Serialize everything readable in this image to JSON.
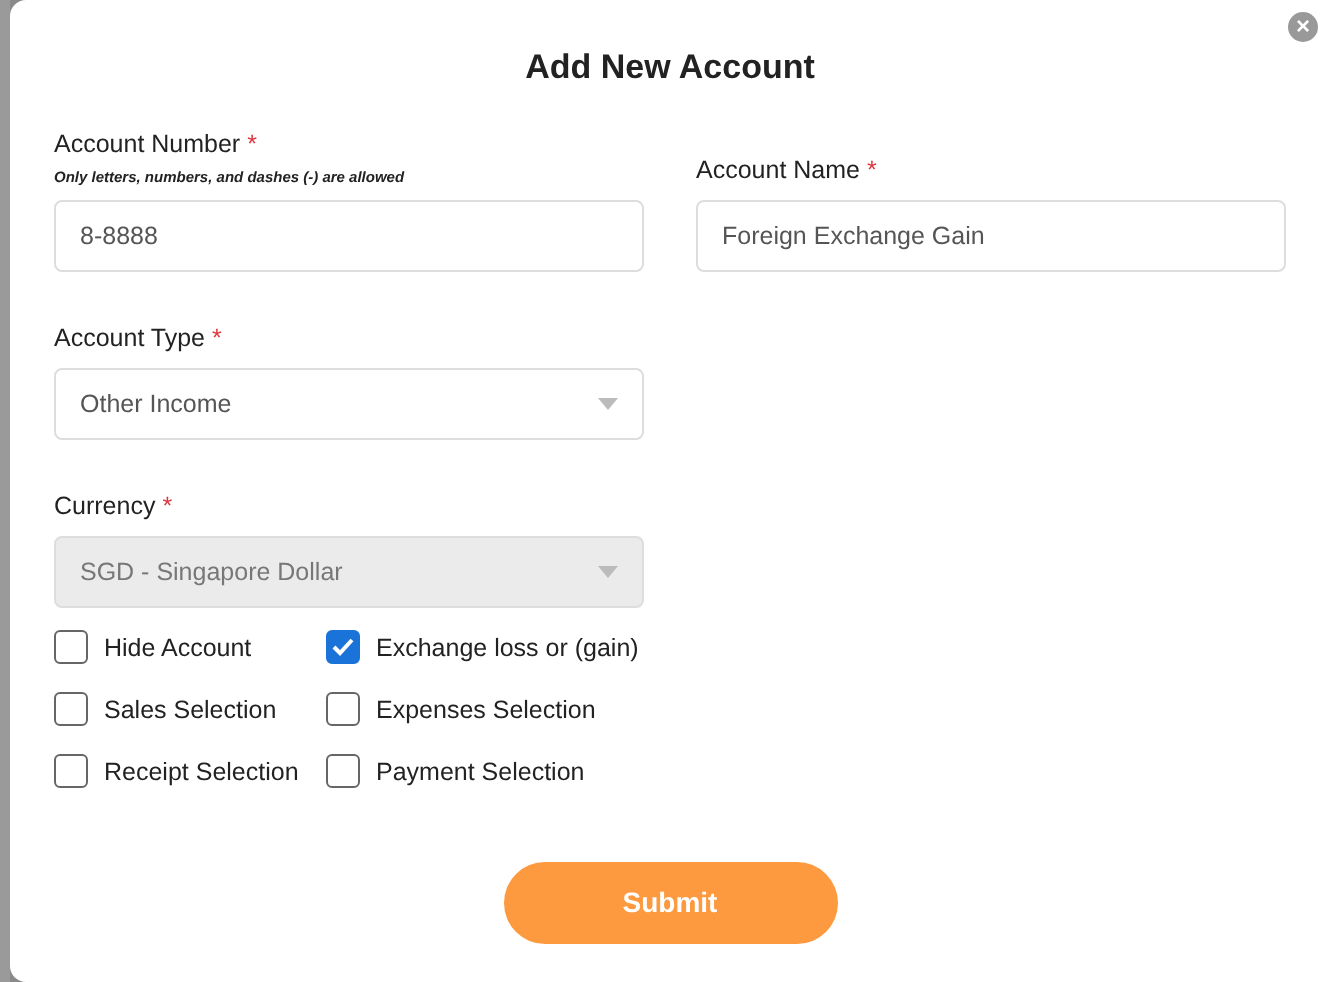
{
  "modal": {
    "title": "Add New Account",
    "close_label": "×"
  },
  "fields": [
    {
      "label": "Account Number",
      "required_mark": "*",
      "hint": "Only letters, numbers, and dashes (-) are allowed",
      "kind": "text",
      "value": "8-8888",
      "disabled": false
    },
    {
      "label": "Account Name",
      "required_mark": "*",
      "kind": "text",
      "value": "Foreign Exchange Gain",
      "disabled": false
    },
    {
      "label": "Account Type",
      "required_mark": "*",
      "kind": "select",
      "value": "Other Income",
      "disabled": false
    },
    {
      "label": "Currency",
      "required_mark": "*",
      "kind": "select",
      "value": "SGD - Singapore Dollar",
      "disabled": true
    }
  ],
  "checkboxes": [
    {
      "label": "Hide Account",
      "checked": false
    },
    {
      "label": "Exchange loss or (gain)",
      "checked": true
    },
    {
      "label": "Sales Selection",
      "checked": false
    },
    {
      "label": "Expenses Selection",
      "checked": false
    },
    {
      "label": "Receipt Selection",
      "checked": false
    },
    {
      "label": "Payment Selection",
      "checked": false
    }
  ],
  "submit_button": "Submit"
}
